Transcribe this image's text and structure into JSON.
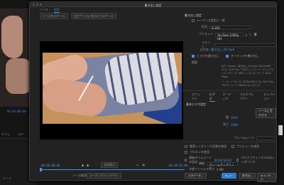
{
  "window": {
    "title": "書き出し設定"
  },
  "source_tabs": [
    "ソース",
    "出力"
  ],
  "source_controls": {
    "crop_label": "ソースをスケール",
    "scale_option": "出力サイズに合わせてスケール"
  },
  "background": {
    "timecode": "00:00:00:00",
    "label_a": "エフェ",
    "label_b": "ロー",
    "label_c": "ツール"
  },
  "timeline": {
    "start_tc": "00:00:00:00",
    "end_tc": "00:00:02:00",
    "fit_label": "全体表示",
    "source_range_label": "ソース範囲",
    "source_range_value": "シーケンスイン/アウト"
  },
  "settings": {
    "section_title": "書き出し設定",
    "match_sequence_label": "シーケンス設定に一致",
    "format_label": "形式",
    "format_value": "H.264",
    "preset_label": "プリセット",
    "preset_value": "YouTube 1080p HD",
    "comment_label": "コメント",
    "comment_value": "",
    "output_label": "出力名",
    "output_value": "書き出し_01.mp4",
    "export_video_label": "ビデオを書き出し",
    "export_audio_label": "オーディオを書き出し",
    "summary_label": "概要",
    "summary_output": "出力: /Users/.../書き出し_01.mp4  1920x1080 (1.0), 29.97 fps, プログレッシブ, ハードウェアエンコーディング, VBR, 1 パス, ターゲット 16.00 Mbps",
    "summary_source": "ソース: シーケンス, 1920x1080 (1.0), 29.97 fps, プログレッシブ, 48000 Hz, ステレオ"
  },
  "tabs": [
    "エフェクト",
    "ビデオ",
    "オーディオ",
    "マルチプレクサー",
    "キャプション"
  ],
  "tabs_active": 1,
  "video_section": {
    "title": "基本ビデオ設定",
    "match_source_button": "ソースに合わせる",
    "width_label": "幅",
    "width_value": "1920",
    "height_label": "高さ",
    "height_value": "1080",
    "frame_rate_label": "フレームレート"
  },
  "bottom_options": {
    "max_render_label": "最高レンダリング品質を使用",
    "preview_label": "プレビューを使用",
    "proxy_label": "プロキシを使用",
    "start_tc_label": "開始タイムコードを設定",
    "start_tc_value": "00:00:00:00",
    "alpha_label": "アルファチャンネルのみレンダリング",
    "interp_label": "補間",
    "interp_value": "フレームサンプリング",
    "size_label": "予想ファイルサイズ",
    "size_value": "4 MB"
  },
  "footer": {
    "metadata": "メタデータ...",
    "queue": "キュー",
    "export": "書き出し",
    "cancel": "キャンセル"
  },
  "colors": {
    "accent": "#4a90e2",
    "dialog_bg": "#222222"
  }
}
